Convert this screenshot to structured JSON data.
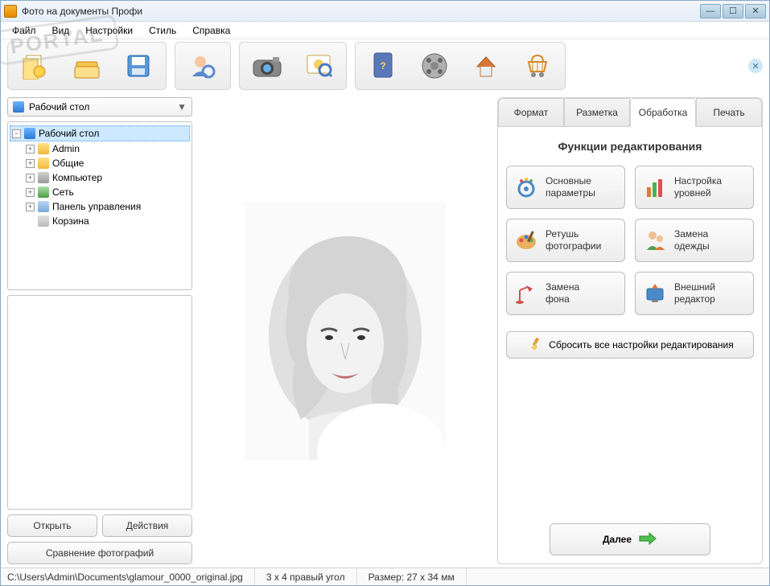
{
  "title": "Фото на документы Профи",
  "menu": {
    "file": "Файл",
    "view": "Вид",
    "settings": "Настройки",
    "style": "Стиль",
    "help": "Справка"
  },
  "combo": {
    "label": "Рабочий стол"
  },
  "tree": {
    "root": "Рабочий стол",
    "items": [
      {
        "label": "Admin",
        "icon": "folder"
      },
      {
        "label": "Общие",
        "icon": "folder"
      },
      {
        "label": "Компьютер",
        "icon": "computer"
      },
      {
        "label": "Сеть",
        "icon": "network"
      },
      {
        "label": "Панель управления",
        "icon": "panel"
      },
      {
        "label": "Корзина",
        "icon": "trash"
      }
    ]
  },
  "leftButtons": {
    "open": "Открыть",
    "actions": "Действия",
    "compare": "Сравнение фотографий"
  },
  "tabs": {
    "format": "Формат",
    "layout": "Разметка",
    "process": "Обработка",
    "print": "Печать",
    "active": "process"
  },
  "panel": {
    "title": "Функции редактирования",
    "funcs": {
      "basic": "Основные\nпараметры",
      "levels": "Настройка\nуровней",
      "retouch": "Ретушь\nфотографии",
      "clothes": "Замена\nодежды",
      "background": "Замена\nфона",
      "external": "Внешний\nредактор"
    },
    "reset": "Сбросить все настройки редактирования",
    "next": "Далее"
  },
  "status": {
    "path": "C:\\Users\\Admin\\Documents\\glamour_0000_original.jpg",
    "corner": "3 x 4 правый угол",
    "size": "Размер: 27 x 34 мм"
  },
  "watermark": "PORTAL"
}
